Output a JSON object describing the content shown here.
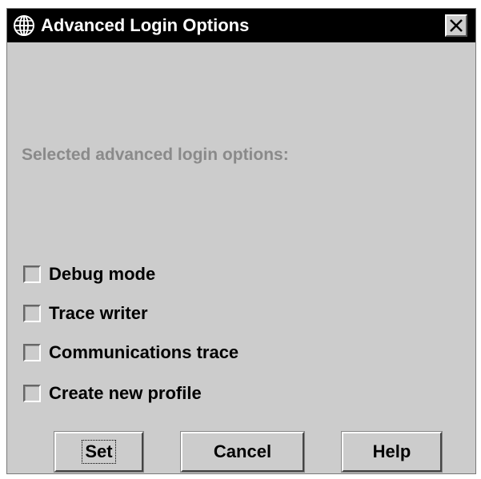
{
  "window": {
    "title": "Advanced Login Options",
    "icon": "globe-icon",
    "close_icon": "close-icon"
  },
  "main": {
    "section_label": "Selected advanced login options:",
    "options": [
      {
        "label": "Debug mode",
        "checked": false
      },
      {
        "label": "Trace writer",
        "checked": false
      },
      {
        "label": "Communications trace",
        "checked": false
      },
      {
        "label": "Create new profile",
        "checked": false
      }
    ]
  },
  "buttons": {
    "set": "Set",
    "cancel": "Cancel",
    "help": "Help"
  },
  "colors": {
    "titlebar": "#000000",
    "dialog_background": "#cccccc",
    "disabled_text": "#8a8a8a"
  }
}
